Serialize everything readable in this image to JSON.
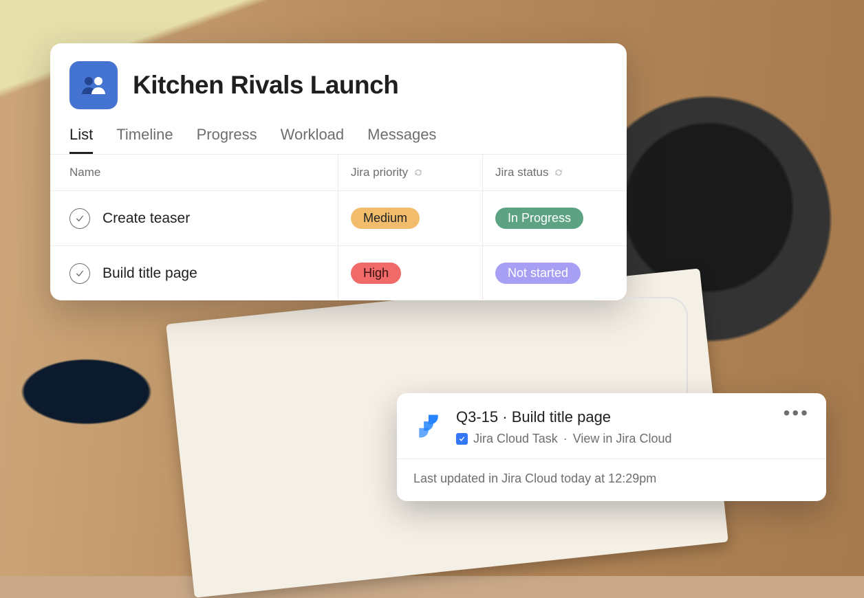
{
  "project": {
    "title": "Kitchen Rivals Launch",
    "tabs": [
      {
        "label": "List",
        "active": true
      },
      {
        "label": "Timeline",
        "active": false
      },
      {
        "label": "Progress",
        "active": false
      },
      {
        "label": "Workload",
        "active": false
      },
      {
        "label": "Messages",
        "active": false
      }
    ],
    "columns": {
      "name": "Name",
      "priority": "Jira priority",
      "status": "Jira status"
    },
    "rows": [
      {
        "name": "Create teaser",
        "priority": "Medium",
        "priority_class": "medium",
        "status": "In Progress",
        "status_class": "inprogress"
      },
      {
        "name": "Build title page",
        "priority": "High",
        "priority_class": "high",
        "status": "Not started",
        "status_class": "notstarted"
      }
    ]
  },
  "detail": {
    "id": "Q3-15",
    "separator": " · ",
    "title": "Build title page",
    "type_label": "Jira Cloud Task",
    "view_link": "View in Jira Cloud",
    "footer": "Last updated in Jira Cloud today at 12:29pm"
  },
  "colors": {
    "brand_blue": "#4573d2",
    "jira_blue": "#2684ff",
    "priority_medium": "#f1bd6c",
    "priority_high": "#f06a6a",
    "status_inprogress": "#5da283",
    "status_notstarted": "#a69ff3"
  }
}
